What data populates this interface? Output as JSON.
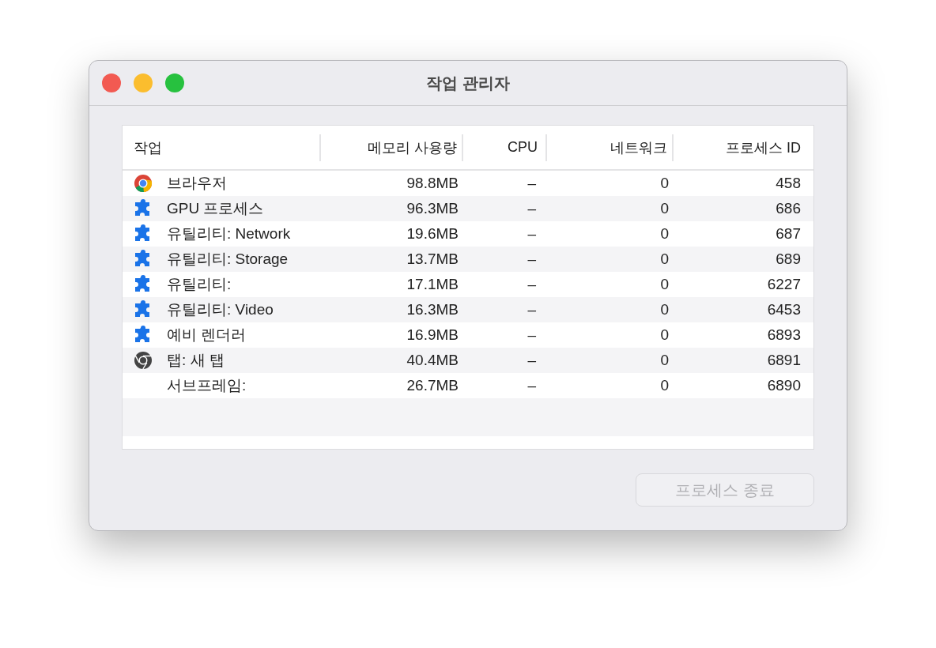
{
  "window": {
    "title": "작업 관리자"
  },
  "table": {
    "columns": [
      "작업",
      "메모리 사용량",
      "CPU",
      "네트워크",
      "프로세스 ID"
    ],
    "rows": [
      {
        "kind": "chrome",
        "name": "브라우저",
        "memory": "98.8MB",
        "cpu": "–",
        "network": "0",
        "pid": "458"
      },
      {
        "kind": "puzzle",
        "name": "GPU 프로세스",
        "memory": "96.3MB",
        "cpu": "–",
        "network": "0",
        "pid": "686"
      },
      {
        "kind": "puzzle",
        "name": "유틸리티: Network",
        "memory": "19.6MB",
        "cpu": "–",
        "network": "0",
        "pid": "687"
      },
      {
        "kind": "puzzle",
        "name": "유틸리티: Storage",
        "memory": "13.7MB",
        "cpu": "–",
        "network": "0",
        "pid": "689"
      },
      {
        "kind": "puzzle",
        "name": "유틸리티:",
        "memory": "17.1MB",
        "cpu": "–",
        "network": "0",
        "pid": "6227"
      },
      {
        "kind": "puzzle",
        "name": "유틸리티: Video",
        "memory": "16.3MB",
        "cpu": "–",
        "network": "0",
        "pid": "6453"
      },
      {
        "kind": "puzzle",
        "name": "예비 렌더러",
        "memory": "16.9MB",
        "cpu": "–",
        "network": "0",
        "pid": "6893"
      },
      {
        "kind": "tab",
        "name": "탭: 새 탭",
        "memory": "40.4MB",
        "cpu": "–",
        "network": "0",
        "pid": "6891"
      },
      {
        "kind": "frame",
        "name": "서브프레임:",
        "memory": "26.7MB",
        "cpu": "–",
        "network": "0",
        "pid": "6890"
      }
    ]
  },
  "end_button": {
    "label": "프로세스 종료",
    "disabled": true
  }
}
